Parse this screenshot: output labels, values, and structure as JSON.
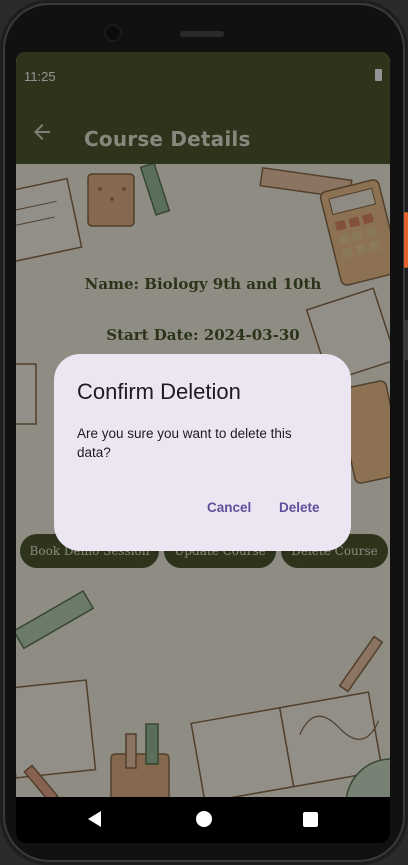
{
  "status_bar": {
    "time": "11:25"
  },
  "appbar": {
    "title": "Course Details",
    "back_icon": "arrow-back-icon"
  },
  "course": {
    "name_line": "Name: Biology 9th and 10th",
    "start_date_line": "Start Date: 2024-03-30"
  },
  "actions": {
    "book_demo": "Book Demo Session",
    "update": "Update Course",
    "delete": "Delete Course"
  },
  "dialog": {
    "title": "Confirm Deletion",
    "message": "Are you sure you want to delete this data?",
    "cancel_label": "Cancel",
    "delete_label": "Delete"
  },
  "navbar": {
    "back_icon": "nav-back-icon",
    "home_icon": "nav-home-icon",
    "recents_icon": "nav-recents-icon"
  },
  "colors": {
    "primary": "#4e5a2f",
    "dialog_bg": "#ece6f2",
    "dialog_action": "#5e509a",
    "background": "#f6f2e4"
  }
}
